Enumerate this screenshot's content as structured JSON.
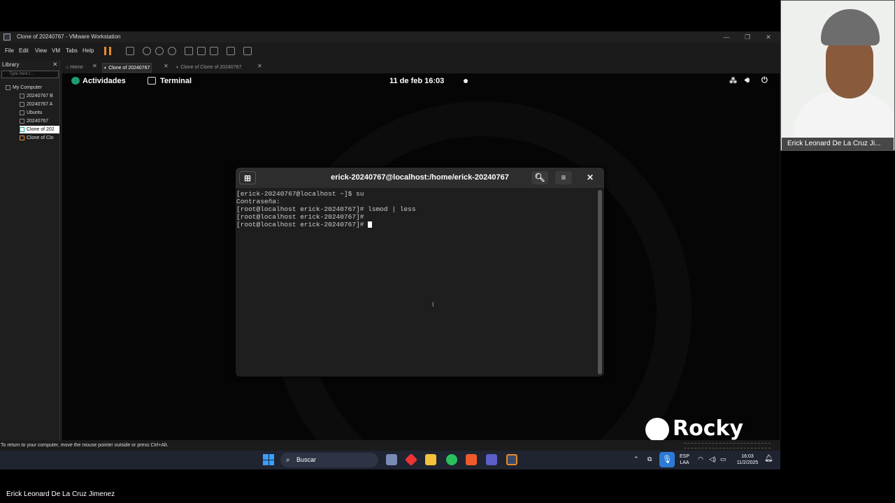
{
  "vmware": {
    "window_title": "Clone of 20240767 - VMware Workstation",
    "menu": [
      "File",
      "Edit",
      "View",
      "VM",
      "Tabs",
      "Help"
    ],
    "library": {
      "title": "Library",
      "search_placeholder": "Type here t...",
      "items": [
        "My Computer",
        "20240767 B",
        "20240767 A",
        "Ubuntu",
        "20240767",
        "Clone of 202",
        "Clone of Clo"
      ],
      "selected_index": 5
    },
    "tabs": [
      {
        "label": "Home",
        "active": false
      },
      {
        "label": "Clone of 20240767",
        "active": true
      },
      {
        "label": "Clone of Clone of 20240767",
        "active": false
      }
    ],
    "status_text": "To return to your computer, move the mouse pointer outside or press Ctrl+Alt."
  },
  "gnome": {
    "activities": "Actividades",
    "app_name": "Terminal",
    "clock": "11 de feb  16:03"
  },
  "terminal": {
    "title": "erick-20240767@localhost:/home/erick-20240767",
    "lines": [
      "[erick-20240767@localhost ~]$ su",
      "Contraseña:",
      "[root@localhost erick-20240767]# lsmod | less",
      "[root@localhost erick-20240767]#",
      "[root@localhost erick-20240767]# "
    ]
  },
  "rocky_logo": "Rocky",
  "taskbar": {
    "search_label": "Buscar",
    "lang": "ESP",
    "lang_sub": "LAA",
    "time": "16:03",
    "date": "11/2/2025"
  },
  "webcam": {
    "name": "Erick Leonard De La Cruz Ji..."
  },
  "presenter_name": "Erick Leonard De La Cruz Jimenez",
  "colors": {
    "accent_green": "#1f9c6d",
    "pause_orange": "#e88a2c",
    "mic_blue": "#2b7bd6"
  }
}
